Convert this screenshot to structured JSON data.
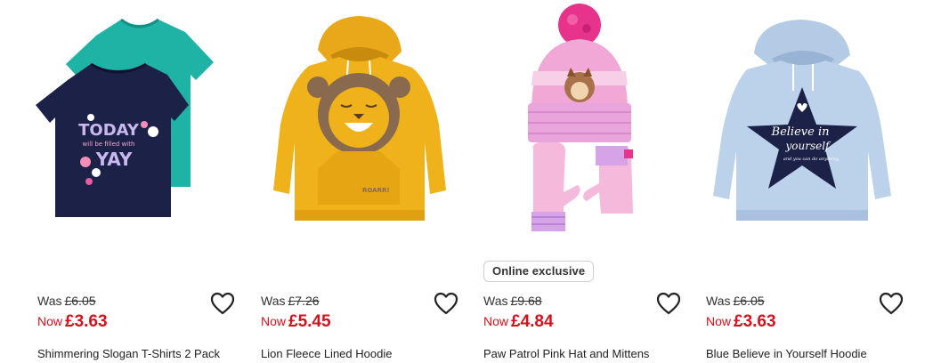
{
  "products": [
    {
      "image_icon": "tshirts-2pack-image",
      "badge": "",
      "was_label": "Was",
      "was_price": "£6.05",
      "now_label": "Now",
      "now_price": "£3.63",
      "name": "Shimmering Slogan T-Shirts 2 Pack",
      "print_text": [
        "TODAY",
        "will be filled with",
        "YAY"
      ]
    },
    {
      "image_icon": "lion-hoodie-image",
      "badge": "",
      "was_label": "Was",
      "was_price": "£7.26",
      "now_label": "Now",
      "now_price": "£5.45",
      "name": "Lion Fleece Lined Hoodie",
      "print_text": [
        "ROARR!"
      ]
    },
    {
      "image_icon": "hat-and-mittens-image",
      "badge": "Online exclusive",
      "was_label": "Was",
      "was_price": "£9.68",
      "now_label": "Now",
      "now_price": "£4.84",
      "name": "Paw Patrol Pink Hat and Mittens",
      "print_text": []
    },
    {
      "image_icon": "blue-hoodie-image",
      "badge": "",
      "was_label": "Was",
      "was_price": "£6.05",
      "now_label": "Now",
      "now_price": "£3.63",
      "name": "Blue Believe in Yourself Hoodie",
      "print_text": [
        "Believe in",
        "yourself",
        "and you can do anything"
      ]
    }
  ],
  "colors": {
    "sale_red": "#d4121c",
    "text": "#222222",
    "badge_border": "#cfcfcf"
  },
  "wishlist_icon": "heart-outline-icon"
}
